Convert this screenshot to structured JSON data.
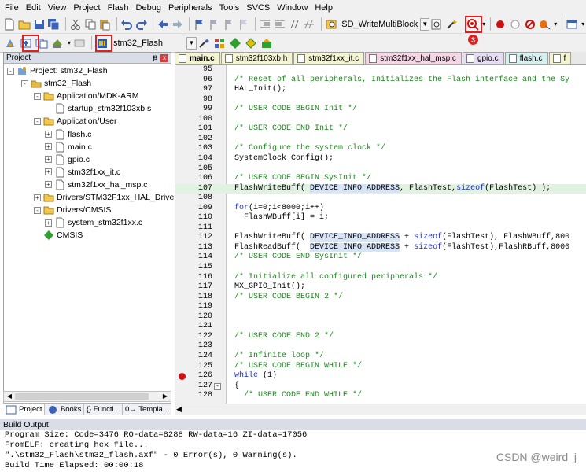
{
  "menu": [
    "File",
    "Edit",
    "View",
    "Project",
    "Flash",
    "Debug",
    "Peripherals",
    "Tools",
    "SVCS",
    "Window",
    "Help"
  ],
  "toolbar": {
    "find_target": "SD_WriteMultiBlock",
    "project_target": "stm32_Flash",
    "badges": [
      "1",
      "2",
      "3"
    ],
    "highlight_color": "#e02020"
  },
  "project_pane": {
    "title": "Project",
    "pin": "ᵽ",
    "close": "x",
    "tree": [
      {
        "label": "Project: stm32_Flash",
        "level": 0,
        "icon": "project-icon",
        "toggle": "-"
      },
      {
        "label": "stm32_Flash",
        "level": 1,
        "icon": "target-icon",
        "toggle": "-"
      },
      {
        "label": "Application/MDK-ARM",
        "level": 2,
        "icon": "folder-icon",
        "toggle": "-"
      },
      {
        "label": "startup_stm32f103xb.s",
        "level": 3,
        "icon": "file-icon",
        "toggle": ""
      },
      {
        "label": "Application/User",
        "level": 2,
        "icon": "folder-icon",
        "toggle": "-"
      },
      {
        "label": "flash.c",
        "level": 3,
        "icon": "file-icon",
        "toggle": "+"
      },
      {
        "label": "main.c",
        "level": 3,
        "icon": "file-icon",
        "toggle": "+"
      },
      {
        "label": "gpio.c",
        "level": 3,
        "icon": "file-icon",
        "toggle": "+"
      },
      {
        "label": "stm32f1xx_it.c",
        "level": 3,
        "icon": "file-icon",
        "toggle": "+"
      },
      {
        "label": "stm32f1xx_hal_msp.c",
        "level": 3,
        "icon": "file-icon",
        "toggle": "+"
      },
      {
        "label": "Drivers/STM32F1xx_HAL_Driver",
        "level": 2,
        "icon": "folder-icon",
        "toggle": "+"
      },
      {
        "label": "Drivers/CMSIS",
        "level": 2,
        "icon": "folder-icon",
        "toggle": "-"
      },
      {
        "label": "system_stm32f1xx.c",
        "level": 3,
        "icon": "file-icon",
        "toggle": "+"
      },
      {
        "label": "CMSIS",
        "level": 2,
        "icon": "diamond-icon",
        "toggle": ""
      }
    ],
    "tabs": [
      "Project",
      "Books",
      "{} Functi...",
      "0→ Templa..."
    ]
  },
  "editor": {
    "tabs": [
      {
        "label": "main.c",
        "color": "#f4f4d0",
        "active": true
      },
      {
        "label": "stm32f103xb.h",
        "color": "#f4f4d0",
        "active": false
      },
      {
        "label": "stm32f1xx_it.c",
        "color": "#f4f4d0",
        "active": false
      },
      {
        "label": "stm32f1xx_hal_msp.c",
        "color": "#f6d6e6",
        "active": false
      },
      {
        "label": "gpio.c",
        "color": "#e6dcf4",
        "active": false
      },
      {
        "label": "flash.c",
        "color": "#d6f0f0",
        "active": false
      },
      {
        "label": "f",
        "color": "#f4f4d0",
        "active": false
      }
    ],
    "lines": [
      {
        "n": "95",
        "t": [],
        "hl": false
      },
      {
        "n": "96",
        "t": [
          [
            "cmt",
            "/* Reset of all peripherals, Initializes the Flash interface and the Sy"
          ]
        ],
        "hl": false
      },
      {
        "n": "97",
        "t": [
          [
            "",
            "HAL_Init();"
          ]
        ],
        "hl": false
      },
      {
        "n": "98",
        "t": [],
        "hl": false
      },
      {
        "n": "99",
        "t": [
          [
            "cmt",
            "/* USER CODE BEGIN Init */"
          ]
        ],
        "hl": false
      },
      {
        "n": "100",
        "t": [],
        "hl": false
      },
      {
        "n": "101",
        "t": [
          [
            "cmt",
            "/* USER CODE END Init */"
          ]
        ],
        "hl": false
      },
      {
        "n": "102",
        "t": [],
        "hl": false
      },
      {
        "n": "103",
        "t": [
          [
            "cmt",
            "/* Configure the system clock */"
          ]
        ],
        "hl": false
      },
      {
        "n": "104",
        "t": [
          [
            "",
            "SystemClock_Config();"
          ]
        ],
        "hl": false
      },
      {
        "n": "105",
        "t": [],
        "hl": false
      },
      {
        "n": "106",
        "t": [
          [
            "cmt",
            "/* USER CODE BEGIN SysInit */"
          ]
        ],
        "hl": false
      },
      {
        "n": "107",
        "t": [
          [
            "",
            "FlashWriteBuff( "
          ],
          [
            "mac",
            "DEVICE_INFO_ADDRESS"
          ],
          [
            "",
            ", FlashTest,"
          ],
          [
            "kw",
            "sizeof"
          ],
          [
            "",
            "(FlashTest) );"
          ]
        ],
        "hl": true
      },
      {
        "n": "108",
        "t": [],
        "hl": false
      },
      {
        "n": "109",
        "t": [
          [
            "kw",
            "for"
          ],
          [
            "",
            "(i=0;i<8000;i++)"
          ]
        ],
        "hl": false
      },
      {
        "n": "110",
        "t": [
          [
            "",
            "  FlashWBuff[i] = i;"
          ]
        ],
        "hl": false
      },
      {
        "n": "111",
        "t": [],
        "hl": false
      },
      {
        "n": "112",
        "t": [
          [
            "",
            "FlashWriteBuff( "
          ],
          [
            "mac",
            "DEVICE_INFO_ADDRESS"
          ],
          [
            "",
            " + "
          ],
          [
            "kw",
            "sizeof"
          ],
          [
            "",
            "(FlashTest), FlashWBuff,800"
          ]
        ],
        "hl": false
      },
      {
        "n": "113",
        "t": [
          [
            "",
            "FlashReadBuff(  "
          ],
          [
            "mac",
            "DEVICE_INFO_ADDRESS"
          ],
          [
            "",
            " + "
          ],
          [
            "kw",
            "sizeof"
          ],
          [
            "",
            "(FlashTest),FlashRBuff,8000"
          ]
        ],
        "hl": false
      },
      {
        "n": "114",
        "t": [
          [
            "cmt",
            "/* USER CODE END SysInit */"
          ]
        ],
        "hl": false
      },
      {
        "n": "115",
        "t": [],
        "hl": false
      },
      {
        "n": "116",
        "t": [
          [
            "cmt",
            "/* Initialize all configured peripherals */"
          ]
        ],
        "hl": false
      },
      {
        "n": "117",
        "t": [
          [
            "",
            "MX_GPIO_Init();"
          ]
        ],
        "hl": false
      },
      {
        "n": "118",
        "t": [
          [
            "cmt",
            "/* USER CODE BEGIN 2 */"
          ]
        ],
        "hl": false
      },
      {
        "n": "119",
        "t": [],
        "hl": false
      },
      {
        "n": "120",
        "t": [],
        "hl": false
      },
      {
        "n": "121",
        "t": [],
        "hl": false
      },
      {
        "n": "122",
        "t": [
          [
            "cmt",
            "/* USER CODE END 2 */"
          ]
        ],
        "hl": false
      },
      {
        "n": "123",
        "t": [],
        "hl": false
      },
      {
        "n": "124",
        "t": [
          [
            "cmt",
            "/* Infinite loop */"
          ]
        ],
        "hl": false
      },
      {
        "n": "125",
        "t": [
          [
            "cmt",
            "/* USER CODE BEGIN WHILE */"
          ]
        ],
        "hl": false
      },
      {
        "n": "126",
        "t": [
          [
            "kw",
            "while"
          ],
          [
            "",
            " (1)"
          ]
        ],
        "hl": false,
        "bp": true
      },
      {
        "n": "127",
        "t": [
          [
            "",
            "{"
          ]
        ],
        "hl": false,
        "fold": true
      },
      {
        "n": "128",
        "t": [
          [
            "cmt",
            "  /* USER CODE END WHILE */"
          ]
        ],
        "hl": false
      }
    ]
  },
  "build_output": {
    "title": "Build Output",
    "lines": [
      "Program Size: Code=3476 RO-data=8288 RW-data=16 ZI-data=17056",
      "FromELF: creating hex file...",
      "\".\\stm32_Flash\\stm32_flash.axf\" - 0 Error(s), 0 Warning(s).",
      "Build Time Elapsed:  00:00:18"
    ]
  },
  "watermark": "CSDN @weird_j"
}
